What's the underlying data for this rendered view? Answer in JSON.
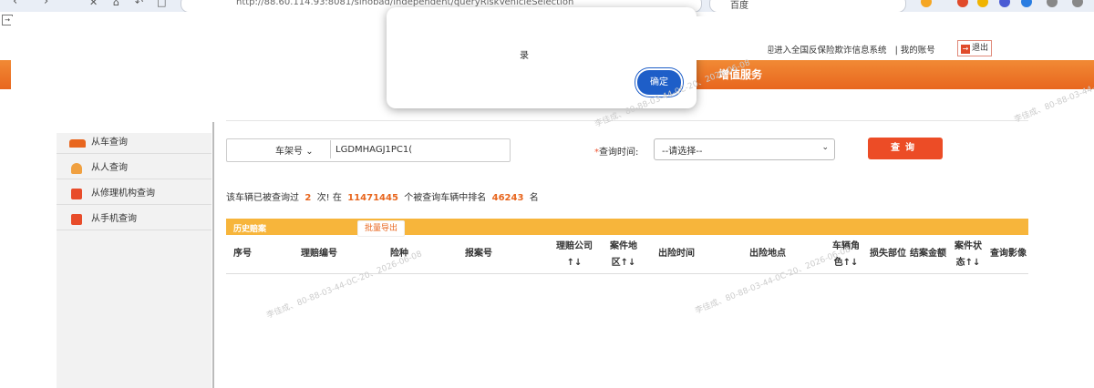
{
  "browser": {
    "url": "http://88.60.114.93:8081/sinobad/independent/queryRiskVehicleSelection",
    "search_text": "百度"
  },
  "header": {
    "welcome": "欢迎进入全国反保险欺诈信息系统",
    "my_account": "我的账号",
    "logout": "退出",
    "band_title": "增值服务"
  },
  "dialog": {
    "message_fragment": "录",
    "ok_label": "确定"
  },
  "sidebar": {
    "items": [
      {
        "label": "从车查询",
        "icon": "car-icon"
      },
      {
        "label": "从人查询",
        "icon": "person-icon"
      },
      {
        "label": "从修理机构查询",
        "icon": "repair-shop-icon"
      },
      {
        "label": "从手机查询",
        "icon": "phone-icon"
      }
    ]
  },
  "search": {
    "field_select": "车架号",
    "field_value": "LGDMHAGJ1PC1(",
    "time_label": "查询时间:",
    "time_select": "--请选择--",
    "query_button": "查询"
  },
  "stats": {
    "prefix": "该车辆已被查询过",
    "count": "2",
    "mid": "次! 在",
    "total": "11471445",
    "mid2": "个被查询车辆中排名",
    "rank": "46243",
    "suffix": "名"
  },
  "table": {
    "tab_label": "历史赔案",
    "export_button": "批量导出",
    "columns": [
      "序号",
      "理赔编号",
      "险种",
      "报案号",
      "理赔公司\n↑↓",
      "案件地\n区↑↓",
      "出险时间",
      "出险地点",
      "车辆角\n色↑↓",
      "损失部位",
      "结案金额",
      "案件状\n态↑↓",
      "查询影像"
    ]
  },
  "watermark": "李佳成、80-88-03-44-0C-20、2026-06-08",
  "colors": {
    "orange": "#e8661e",
    "tab_yellow": "#f7b53b",
    "button_red": "#ec4c26",
    "dialog_blue": "#1e5ec8"
  }
}
